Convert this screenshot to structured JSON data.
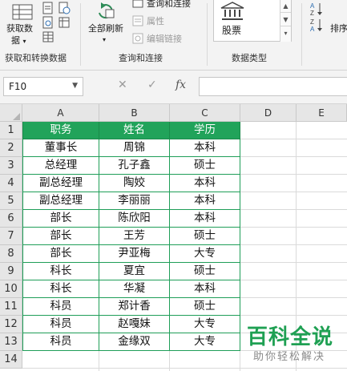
{
  "ribbon": {
    "get_data": {
      "line1": "获取数",
      "line2": "据",
      "arrow": "▾"
    },
    "refresh_all": {
      "label": "全部刷新",
      "arrow": "▾"
    },
    "query_connect": "查询和连接",
    "properties": "属性",
    "edit_links": "编辑链接",
    "stock": "股票",
    "sort_partial": "排序",
    "groups": {
      "get_transform": "获取和转换数据",
      "queries": "查询和连接",
      "data_types": "数据类型"
    }
  },
  "formula_bar": {
    "cell_ref": "F10",
    "cancel": "✕",
    "enter": "✓",
    "fx": "fx",
    "value": ""
  },
  "grid": {
    "columns": [
      "A",
      "B",
      "C",
      "D",
      "E"
    ],
    "rows": [
      "1",
      "2",
      "3",
      "4",
      "5",
      "6",
      "7",
      "8",
      "9",
      "10",
      "11",
      "12",
      "13",
      "14"
    ],
    "headers": [
      "职务",
      "姓名",
      "学历"
    ],
    "data": [
      [
        "董事长",
        "周锦",
        "本科"
      ],
      [
        "总经理",
        "孔子鑫",
        "硕士"
      ],
      [
        "副总经理",
        "陶姣",
        "本科"
      ],
      [
        "副总经理",
        "李丽丽",
        "本科"
      ],
      [
        "部长",
        "陈欣阳",
        "本科"
      ],
      [
        "部长",
        "王芳",
        "硕士"
      ],
      [
        "部长",
        "尹亚梅",
        "大专"
      ],
      [
        "科长",
        "夏宜",
        "硕士"
      ],
      [
        "科长",
        "华凝",
        "本科"
      ],
      [
        "科员",
        "郑计香",
        "硕士"
      ],
      [
        "科员",
        "赵嘎妹",
        "大专"
      ],
      [
        "科员",
        "金缘双",
        "大专"
      ]
    ]
  },
  "watermark": {
    "title": "百科全说",
    "subtitle": "助你轻松解决"
  },
  "colors": {
    "header_fill": "#21a35a",
    "border_green": "#1f9e58",
    "watermark_green": "#1fa053"
  }
}
